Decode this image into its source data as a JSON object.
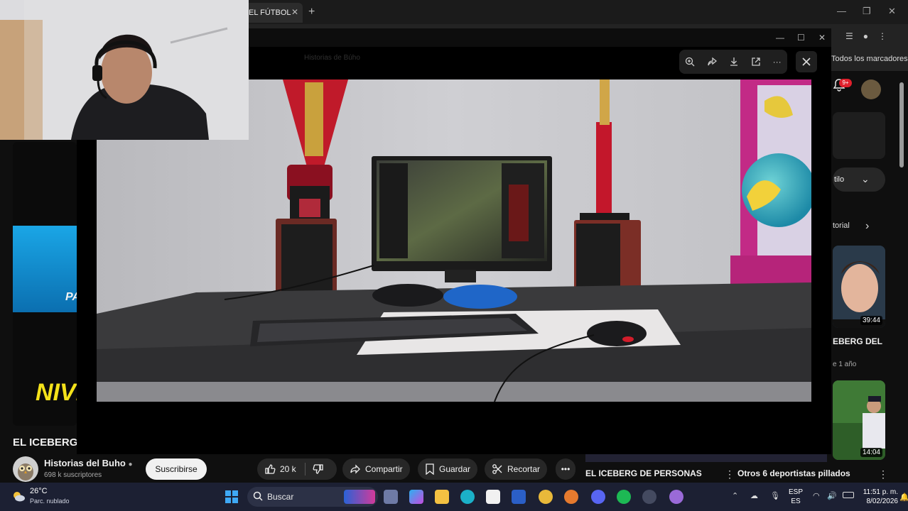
{
  "browser": {
    "tab_title": "EL FÚTBOL",
    "bookmarks_right": "Todos los marcadores",
    "faded_address": "Historias de Búho"
  },
  "viewer": {
    "toolbar_icons": [
      "zoom-in-icon",
      "share-icon",
      "download-icon",
      "open-external-icon",
      "more-icon"
    ]
  },
  "left_thumb": {
    "overlay_short": "PA",
    "overlay_big": "NIVE"
  },
  "video": {
    "title": "EL ICEBERG",
    "channel_name": "Historias del Buho",
    "subscribers": "698 k suscriptores",
    "subscribe_label": "Suscribirse",
    "likes": "20 k",
    "share_label": "Compartir",
    "save_label": "Guardar",
    "clip_label": "Recortar"
  },
  "right_column": {
    "notif_badge": "9+",
    "chip_label": "tilo",
    "section_label": "torial",
    "rec1_duration": "39:44",
    "rec1_title": "EBERG DEL",
    "rec1_meta": "e 1 año",
    "rec2_duration": "14:04",
    "bottom_title1": "EL ICEBERG DE PERSONAS",
    "bottom_title2": "Otros 6 deportistas pillados"
  },
  "taskbar": {
    "temperature": "26°C",
    "weather": "Parc. nublado",
    "search_placeholder": "Buscar",
    "lang_top": "ESP",
    "lang_bottom": "ES",
    "time": "11:51 p. m.",
    "date": "8/02/2026"
  },
  "colors": {
    "background": "#0f0f0f",
    "taskbar": "#1c2033",
    "youtube_red": "#e1202c",
    "yellow_text": "#f4e21a"
  }
}
